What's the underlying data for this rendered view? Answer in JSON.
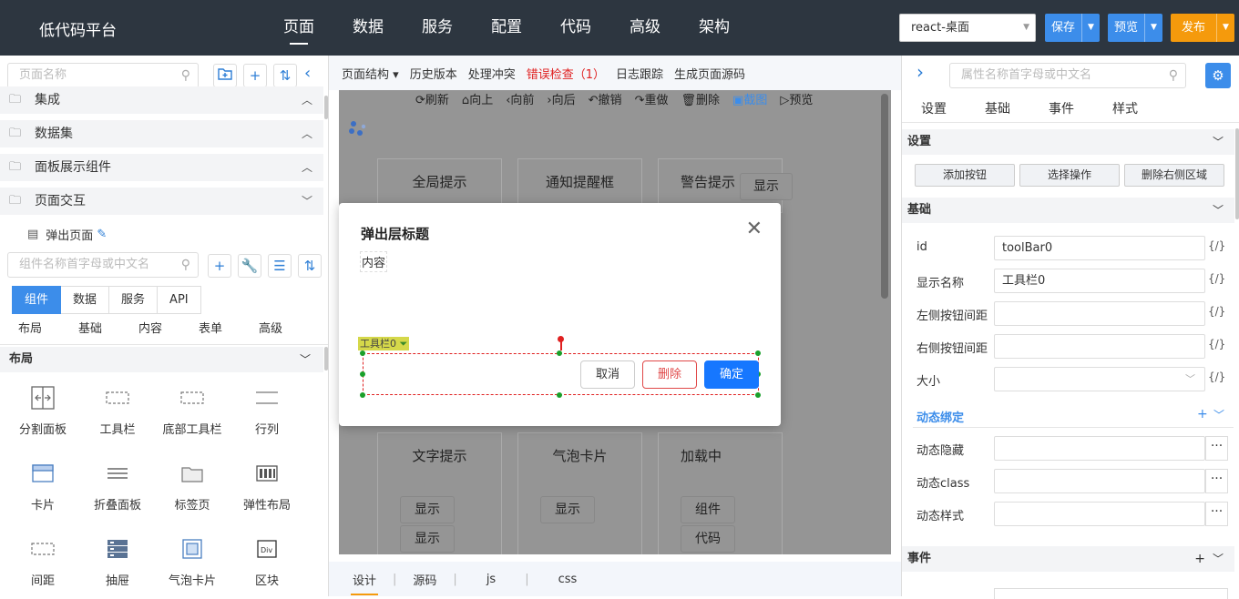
{
  "app": {
    "title": "低代码平台"
  },
  "nav": {
    "items": [
      "页面",
      "数据",
      "服务",
      "配置",
      "代码",
      "高级",
      "架构"
    ],
    "active": "页面"
  },
  "header": {
    "env_select": "react-桌面",
    "save": "保存",
    "preview": "预览",
    "publish": "发布"
  },
  "left": {
    "page_search_placeholder": "页面名称",
    "tree": [
      "集成",
      "数据集",
      "面板展示组件",
      "页面交互"
    ],
    "page_item": "弹出页面",
    "comp_search_placeholder": "组件名称首字母或中文名",
    "tabs": [
      "组件",
      "数据",
      "服务",
      "API"
    ],
    "subtabs": [
      "布局",
      "基础",
      "内容",
      "表单",
      "高级"
    ],
    "section": "布局",
    "components": [
      {
        "label": "分割面板",
        "icon": "split-panel-icon"
      },
      {
        "label": "工具栏",
        "icon": "toolbar-icon"
      },
      {
        "label": "底部工具栏",
        "icon": "bottom-toolbar-icon"
      },
      {
        "label": "行列",
        "icon": "row-col-icon"
      },
      {
        "label": "卡片",
        "icon": "card-icon"
      },
      {
        "label": "折叠面板",
        "icon": "collapse-icon"
      },
      {
        "label": "标签页",
        "icon": "tabs-icon"
      },
      {
        "label": "弹性布局",
        "icon": "flex-layout-icon"
      },
      {
        "label": "间距",
        "icon": "spacing-icon"
      },
      {
        "label": "抽屉",
        "icon": "drawer-icon"
      },
      {
        "label": "气泡卡片",
        "icon": "popover-icon"
      },
      {
        "label": "区块",
        "icon": "div-icon"
      }
    ]
  },
  "mid": {
    "toolbar": [
      "页面结构",
      "历史版本",
      "处理冲突",
      "错误检查（1）",
      "日志跟踪",
      "生成页面源码"
    ],
    "actions": [
      "刷新",
      "向上",
      "向前",
      "向后",
      "撤销",
      "重做",
      "删除",
      "截图",
      "预览"
    ],
    "cards": [
      "全局提示",
      "通知提醒框",
      "警告提示",
      "文字提示",
      "气泡卡片",
      "加载中"
    ],
    "buttons": {
      "show": "显示",
      "component": "组件",
      "code": "代码"
    },
    "modal": {
      "title": "弹出层标题",
      "content": "内容",
      "toolbar_tag": "工具栏0",
      "cancel": "取消",
      "delete": "删除",
      "ok": "确定"
    },
    "bottom_tabs": [
      "设计",
      "源码",
      "js",
      "css"
    ]
  },
  "right": {
    "search_placeholder": "属性名称首字母或中文名",
    "tabs": [
      "设置",
      "基础",
      "事件",
      "样式"
    ],
    "sec_settings": "设置",
    "actions": [
      "添加按钮",
      "选择操作",
      "删除右侧区域"
    ],
    "sec_basic": "基础",
    "props": [
      {
        "label": "id",
        "value": "toolBar0"
      },
      {
        "label": "显示名称",
        "value": "工具栏0"
      },
      {
        "label": "左侧按钮间距",
        "value": ""
      },
      {
        "label": "右侧按钮间距",
        "value": ""
      },
      {
        "label": "大小",
        "value": ""
      }
    ],
    "code_tag": "{/}",
    "dynamic": "动态绑定",
    "dyn_props": [
      "动态隐藏",
      "动态class",
      "动态样式"
    ],
    "sec_events": "事件",
    "colors": {
      "accent": "#3c8dea",
      "orange": "#f59a0c",
      "error": "#e02020"
    }
  }
}
